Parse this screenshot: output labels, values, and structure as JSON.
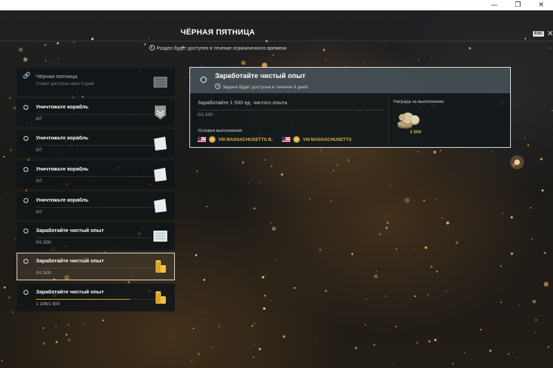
{
  "window": {
    "minimize": "—",
    "restore": "❐",
    "close": "✕"
  },
  "header": {
    "title": "ЧЁРНАЯ ПЯТНИЦА",
    "subtitle": "Раздел будет доступен в течение ограниченного времени",
    "esc_label": "ESC",
    "close_glyph": "✕"
  },
  "tasks": [
    {
      "title": "Чёрная пятница",
      "sub": "Станет доступна через 5 дней",
      "locked": true,
      "thumb": "map-icon"
    },
    {
      "title": "Уничтожьте корабль",
      "progress": "0/7",
      "fill": 0,
      "thumb": "rank-chevron-icon"
    },
    {
      "title": "Уничтожьте корабль",
      "progress": "0/7",
      "fill": 0,
      "thumb": "flag-icon"
    },
    {
      "title": "Уничтожьте корабль",
      "progress": "0/7",
      "fill": 0,
      "thumb": "flag-icon"
    },
    {
      "title": "Уничтожьте корабль",
      "progress": "0/7",
      "fill": 0,
      "thumb": "flag-icon"
    },
    {
      "title": "Заработайте чистый опыт",
      "progress": "0/1 500",
      "fill": 0,
      "thumb": "map-icon"
    },
    {
      "title": "Заработайте чистый опыт",
      "progress": "0/1 500",
      "fill": 0,
      "thumb": "credits-icon",
      "selected": true
    },
    {
      "title": "Заработайте чистый опыт",
      "progress": "1 106/1 500",
      "fill": 0.737,
      "thumb": "credits-icon"
    }
  ],
  "detail": {
    "title": "Заработайте чистый опыт",
    "availability": "Задача будет доступна в течение 9 дней",
    "goal": "Заработайте 1 500 ед. чистого опыта",
    "progress": "0/1 500",
    "conditions_label": "Условия выполнения:",
    "ships": [
      "VIII MASSACHUSETTS B,",
      "VIII MASSACHUSETTS"
    ],
    "reward_label": "Награда за выполнение:",
    "reward_value": "2 500"
  },
  "colors": {
    "accent": "#e3a62b",
    "gold_text": "#e3b54a"
  }
}
